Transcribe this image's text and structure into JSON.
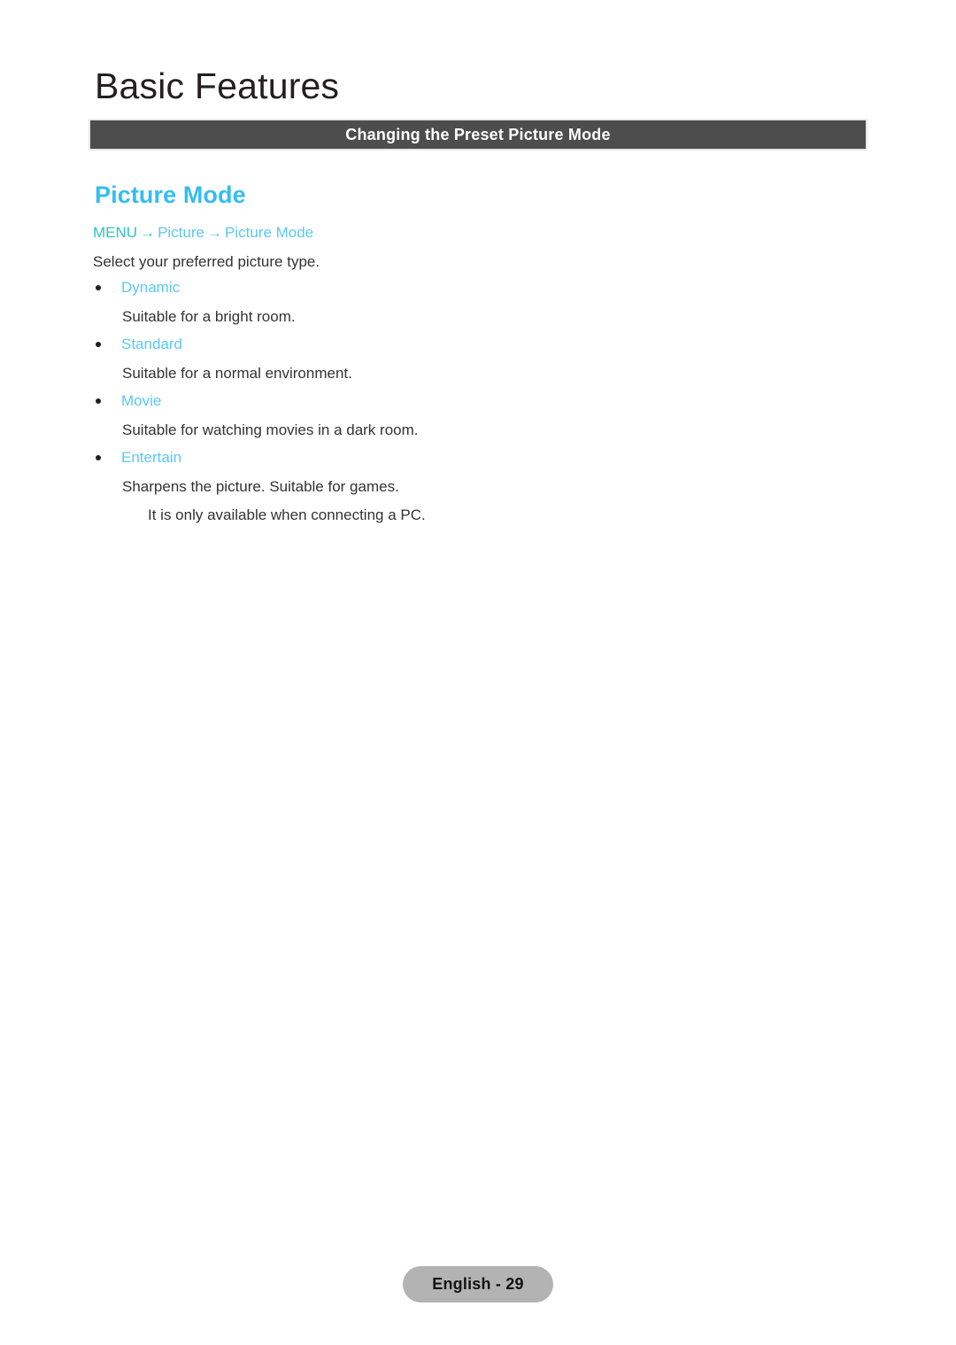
{
  "document": {
    "chapter_title": "Basic Features",
    "section_bar_label": "Changing the Preset Picture Mode"
  },
  "feature": {
    "heading": "Picture Mode",
    "menu_path": {
      "root": "MENU",
      "arrow": "→",
      "nodes": [
        "Picture",
        "Picture Mode"
      ]
    },
    "intro": "Select your preferred picture type.",
    "options": [
      {
        "label": "Dynamic",
        "description": "Suitable for a bright room.",
        "note": ""
      },
      {
        "label": "Standard",
        "description": "Suitable for a normal environment.",
        "note": ""
      },
      {
        "label": "Movie",
        "description": "Suitable for watching movies in a dark room.",
        "note": ""
      },
      {
        "label": "Entertain",
        "description": "Sharpens the picture. Suitable for games.",
        "note": "It is only available when connecting a PC."
      }
    ]
  },
  "footer": {
    "page_badge": "English - 29"
  },
  "colors": {
    "accent_cyan": "#33bdf0",
    "link_cyan": "#5bc8f5",
    "menu_teal": "#2ec3c0",
    "bar_gray": "#4d4d4d",
    "badge_gray": "#b3b3b3",
    "body_text": "#333333"
  }
}
